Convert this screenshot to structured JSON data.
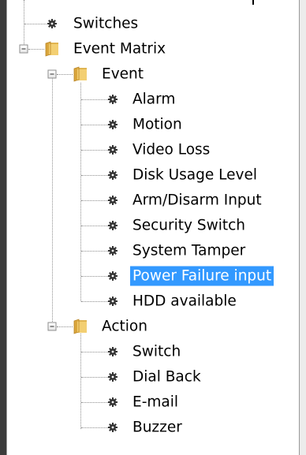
{
  "tree": {
    "top_item": {
      "label": "Switches"
    },
    "event_matrix": {
      "label": "Event Matrix",
      "event_group": {
        "label": "Event",
        "items": [
          {
            "label": "Alarm"
          },
          {
            "label": "Motion"
          },
          {
            "label": "Video Loss"
          },
          {
            "label": "Disk Usage Level"
          },
          {
            "label": "Arm/Disarm Input"
          },
          {
            "label": "Security Switch"
          },
          {
            "label": "System Tamper"
          },
          {
            "label": "Power Failure input",
            "selected": true
          },
          {
            "label": "HDD available"
          }
        ]
      },
      "action_group": {
        "label": "Action",
        "items": [
          {
            "label": "Switch"
          },
          {
            "label": "Dial Back"
          },
          {
            "label": "E-mail"
          },
          {
            "label": "Buzzer"
          }
        ]
      }
    }
  },
  "colors": {
    "selection_bg": "#3399ff",
    "selection_text": "#ffffff",
    "folder": "#e8b64c"
  },
  "icons": {
    "leaf": "gear-icon",
    "group": "folder-icon",
    "expander": "collapse-minus-icon"
  }
}
